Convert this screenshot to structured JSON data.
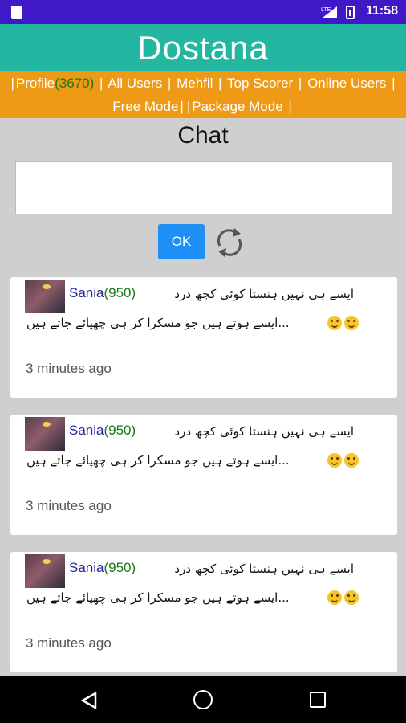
{
  "status_bar": {
    "time": "11:58",
    "network_label": "LTE"
  },
  "header": {
    "title": "Dostana"
  },
  "nav": {
    "profile_label": "Profile",
    "profile_score": "(3670)",
    "all_users": "All Users",
    "mehfil": "Mehfil",
    "top_scorer": "Top Scorer",
    "online_users": "Online Users",
    "free_mode": "Free Mode",
    "package_mode": "Package Mode"
  },
  "chat": {
    "title": "Chat",
    "input_value": "",
    "ok_label": "OK"
  },
  "messages": [
    {
      "user": "Sania",
      "score": "(950)",
      "line1": "ایسے ہی نہیں ہنستا کوئی کچھ درد",
      "line2": "...ایسے ہوتے ہیں جو مسکرا کر ہی چھپائے جاتے ہیں",
      "time": "3 minutes ago"
    },
    {
      "user": "Sania",
      "score": "(950)",
      "line1": "ایسے ہی نہیں ہنستا کوئی کچھ درد",
      "line2": "...ایسے ہوتے ہیں جو مسکرا کر ہی چھپائے جاتے ہیں",
      "time": "3 minutes ago"
    },
    {
      "user": "Sania",
      "score": "(950)",
      "line1": "ایسے ہی نہیں ہنستا کوئی کچھ درد",
      "line2": "...ایسے ہوتے ہیں جو مسکرا کر ہی چھپائے جاتے ہیں",
      "time": "3 minutes ago"
    }
  ],
  "colors": {
    "header": "#23b6a0",
    "nav": "#ef9a16",
    "status_bar": "#3f18c8",
    "button": "#1e8ff5",
    "score": "#1b7a18",
    "username": "#23229a"
  }
}
